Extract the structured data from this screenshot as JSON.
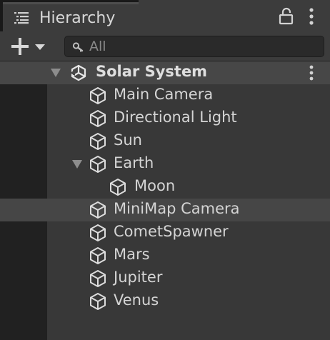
{
  "window": {
    "tab_title": "Hierarchy",
    "tab_icon": "hierarchy-list-icon",
    "lock_icon": "lock-icon",
    "menu_icon": "kebab-menu-icon"
  },
  "toolbar": {
    "add_icon": "plus-dropdown-icon",
    "search": {
      "placeholder": "All",
      "value": "",
      "icon": "search-icon"
    }
  },
  "scene": {
    "name": "Solar System",
    "icon": "unity-logo-icon",
    "expanded": true
  },
  "items": [
    {
      "label": "Main Camera",
      "depth": 1,
      "icon": "gameobject-cube-icon"
    },
    {
      "label": "Directional Light",
      "depth": 1,
      "icon": "gameobject-cube-icon"
    },
    {
      "label": "Sun",
      "depth": 1,
      "icon": "gameobject-cube-icon"
    },
    {
      "label": "Earth",
      "depth": 1,
      "icon": "gameobject-cube-icon",
      "expanded": true
    },
    {
      "label": "Moon",
      "depth": 2,
      "icon": "gameobject-cube-icon"
    },
    {
      "label": "MiniMap Camera",
      "depth": 1,
      "icon": "gameobject-cube-icon",
      "selected": true
    },
    {
      "label": "CometSpawner",
      "depth": 1,
      "icon": "gameobject-cube-icon"
    },
    {
      "label": "Mars",
      "depth": 1,
      "icon": "gameobject-cube-icon"
    },
    {
      "label": "Jupiter",
      "depth": 1,
      "icon": "gameobject-cube-icon"
    },
    {
      "label": "Venus",
      "depth": 1,
      "icon": "gameobject-cube-icon"
    }
  ],
  "colors": {
    "background": "#282828",
    "panel": "#383838",
    "text": "#d4d4d4",
    "highlight": "#464646"
  }
}
